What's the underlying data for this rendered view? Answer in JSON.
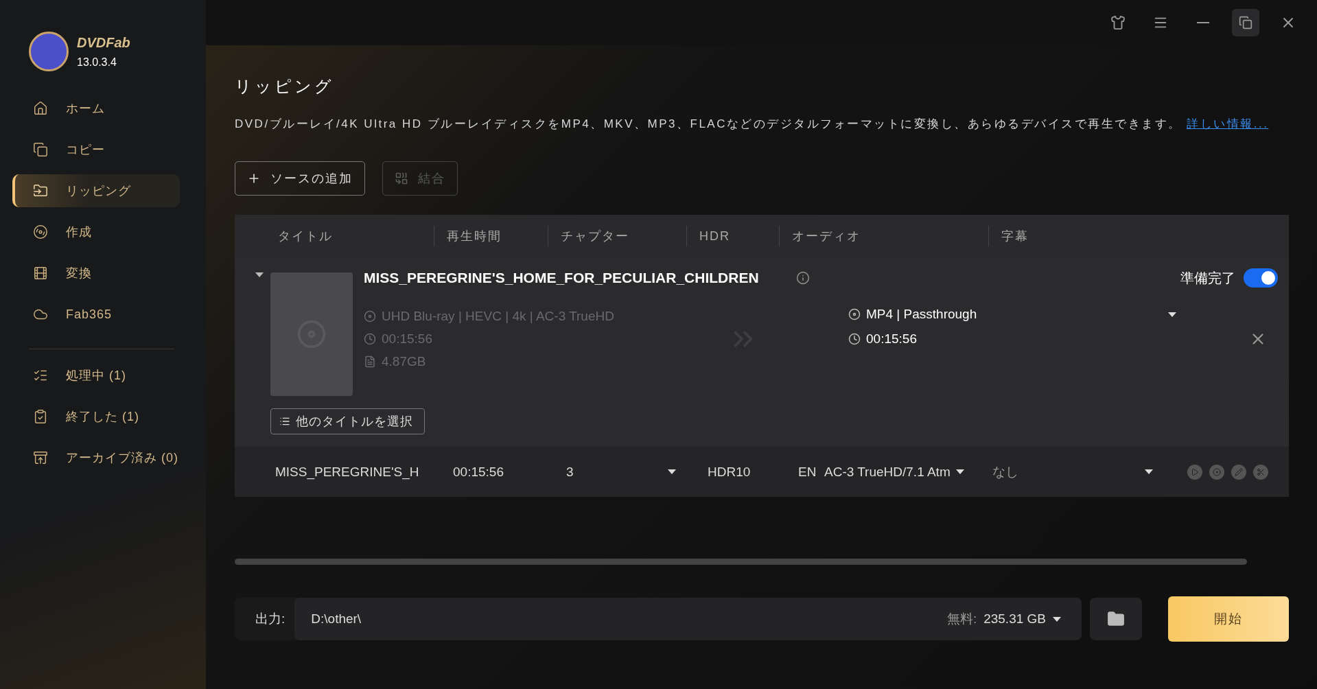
{
  "app": {
    "brand": "DVDFab",
    "version": "13.0.3.4"
  },
  "sidebar": {
    "items": [
      {
        "kind": "home",
        "label": "ホーム",
        "selected": false
      },
      {
        "kind": "copy",
        "label": "コピー",
        "selected": false
      },
      {
        "kind": "ripper",
        "label": "リッピング",
        "selected": true
      },
      {
        "kind": "creator",
        "label": "作成",
        "selected": false
      },
      {
        "kind": "converter",
        "label": "変換",
        "selected": false
      },
      {
        "kind": "fab365",
        "label": "Fab365",
        "selected": false
      }
    ],
    "queue": [
      {
        "kind": "processing",
        "label": "処理中 (1)",
        "selected": false
      },
      {
        "kind": "finished",
        "label": "終了した (1)",
        "selected": false
      },
      {
        "kind": "archived",
        "label": "アーカイブ済み (0)",
        "selected": false
      }
    ]
  },
  "page": {
    "title": "リッピング",
    "description": "DVD/ブルーレイ/4K Ultra HD ブルーレイディスクをMP4、MKV、MP3、FLACなどのデジタルフォーマットに変換し、あらゆるデバイスで再生できます。",
    "link": "詳しい情報..."
  },
  "toolbar": [
    {
      "kind": "add",
      "label": "ソースの追加",
      "disabled": false
    },
    {
      "kind": "merge",
      "label": "結合",
      "disabled": true
    }
  ],
  "table": {
    "columns": [
      "タイトル",
      "再生時間",
      "チャプター",
      "HDR",
      "オーディオ",
      "字幕"
    ],
    "item": {
      "expanded": true,
      "name": "MISS_PEREGRINE'S_HOME_FOR_PECULIAR_CHILDREN",
      "status": "準備完了",
      "ready": true,
      "source": [
        {
          "kind": "disc",
          "text": "UHD Blu-ray | HEVC | 4k | AC-3 TrueHD"
        },
        {
          "kind": "time",
          "text": "00:15:56"
        },
        {
          "kind": "size",
          "text": "4.87GB"
        }
      ],
      "output": [
        {
          "kind": "disc",
          "text": "MP4 | Passthrough"
        },
        {
          "kind": "time",
          "text": "00:15:56"
        }
      ],
      "select_titles": "他のタイトルを選択",
      "row": {
        "title": "MISS_PEREGRINE'S_H",
        "duration": "00:15:56",
        "chapters": "3",
        "hdr": "HDR10",
        "audio_lang": "EN",
        "audio": "AC-3 TrueHD/7.1  Atm",
        "subtitle": "なし"
      }
    }
  },
  "output_bar": {
    "label": "出力:",
    "path": "D:\\other\\",
    "free_label": "無料:",
    "free_value": "235.31 GB"
  },
  "start_button": "開始"
}
